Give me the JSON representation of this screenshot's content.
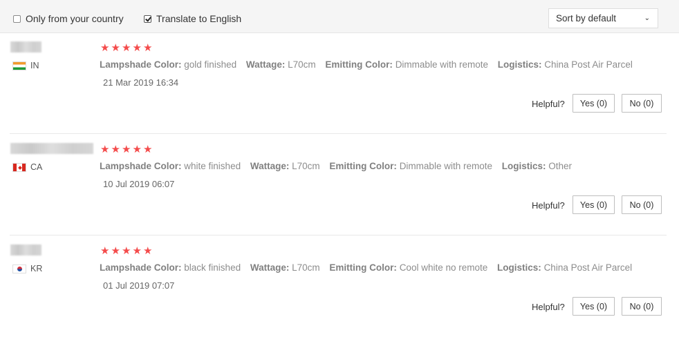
{
  "filters": {
    "only_country_label": "Only from your country",
    "only_country_checked": false,
    "translate_label": "Translate to English",
    "translate_checked": true,
    "sort_value": "Sort by default"
  },
  "icons": {
    "star": "star-icon",
    "chevron": "chevron-down-icon",
    "checkbox_check": "check-icon"
  },
  "colors": {
    "star": "#f44b4b",
    "filter_bg": "#f5f5f5"
  },
  "reviews": [
    {
      "country_code": "IN",
      "rating": 5,
      "attributes": [
        {
          "key": "Lampshade Color:",
          "value": "gold finished"
        },
        {
          "key": "Wattage:",
          "value": "L70cm"
        },
        {
          "key": "Emitting Color:",
          "value": "Dimmable with remote"
        },
        {
          "key": "Logistics:",
          "value": "China Post Air Parcel"
        }
      ],
      "date": "21 Mar 2019 16:34",
      "helpful_label": "Helpful?",
      "yes_label": "Yes (0)",
      "no_label": "No (0)"
    },
    {
      "country_code": "CA",
      "rating": 5,
      "attributes": [
        {
          "key": "Lampshade Color:",
          "value": "white finished"
        },
        {
          "key": "Wattage:",
          "value": "L70cm"
        },
        {
          "key": "Emitting Color:",
          "value": "Dimmable with remote"
        },
        {
          "key": "Logistics:",
          "value": "Other"
        }
      ],
      "date": "10 Jul 2019 06:07",
      "helpful_label": "Helpful?",
      "yes_label": "Yes (0)",
      "no_label": "No (0)"
    },
    {
      "country_code": "KR",
      "rating": 5,
      "attributes": [
        {
          "key": "Lampshade Color:",
          "value": "black finished"
        },
        {
          "key": "Wattage:",
          "value": "L70cm"
        },
        {
          "key": "Emitting Color:",
          "value": "Cool white no remote"
        },
        {
          "key": "Logistics:",
          "value": "China Post Air Parcel"
        }
      ],
      "date": "01 Jul 2019 07:07",
      "helpful_label": "Helpful?",
      "yes_label": "Yes (0)",
      "no_label": "No (0)"
    }
  ]
}
